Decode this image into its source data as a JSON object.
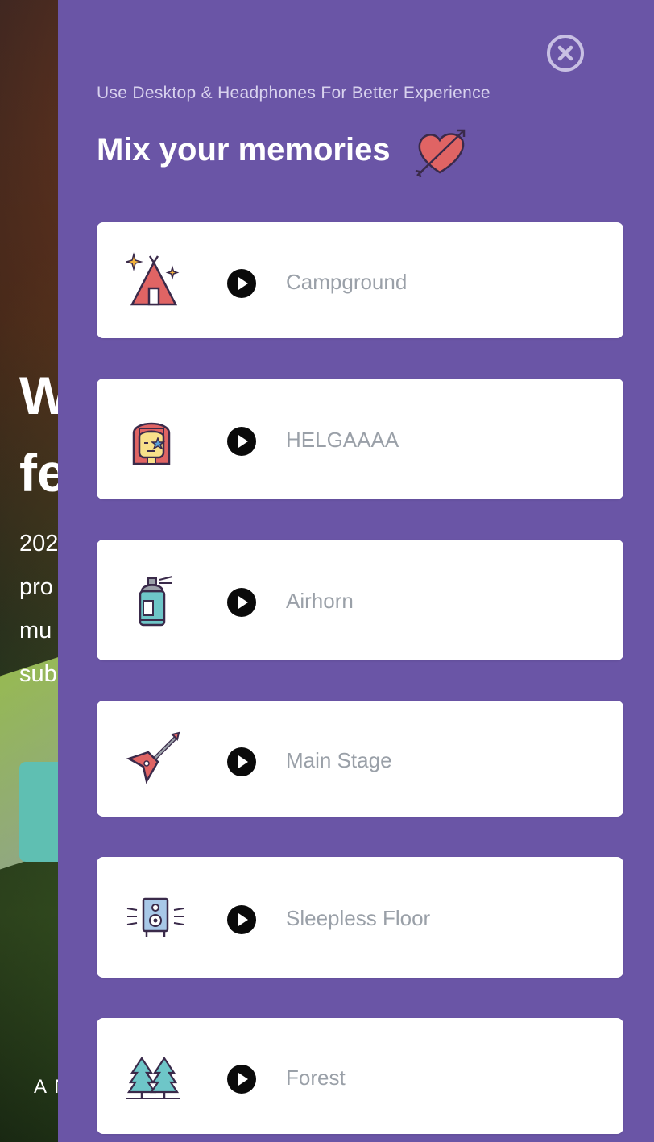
{
  "background": {
    "heading_lines": [
      "W",
      "fe"
    ],
    "paragraph_lines": [
      "202",
      "pro",
      "mu",
      "sub"
    ],
    "footer": "A N"
  },
  "panel": {
    "subtitle": "Use Desktop & Headphones For Better Experience",
    "title": "Mix your memories",
    "title_icon": "heart-arrow-icon",
    "close_icon": "close-circle-icon",
    "accent_color": "#6a55a6",
    "sounds": [
      {
        "label": "Campground",
        "icon": "tent-icon"
      },
      {
        "label": "HELGAAAA",
        "icon": "helga-face-icon"
      },
      {
        "label": "Airhorn",
        "icon": "spray-can-icon"
      },
      {
        "label": "Main Stage",
        "icon": "guitar-icon"
      },
      {
        "label": "Sleepless Floor",
        "icon": "speaker-icon"
      },
      {
        "label": "Forest",
        "icon": "pine-trees-icon"
      }
    ],
    "play_icon": "play-icon"
  }
}
